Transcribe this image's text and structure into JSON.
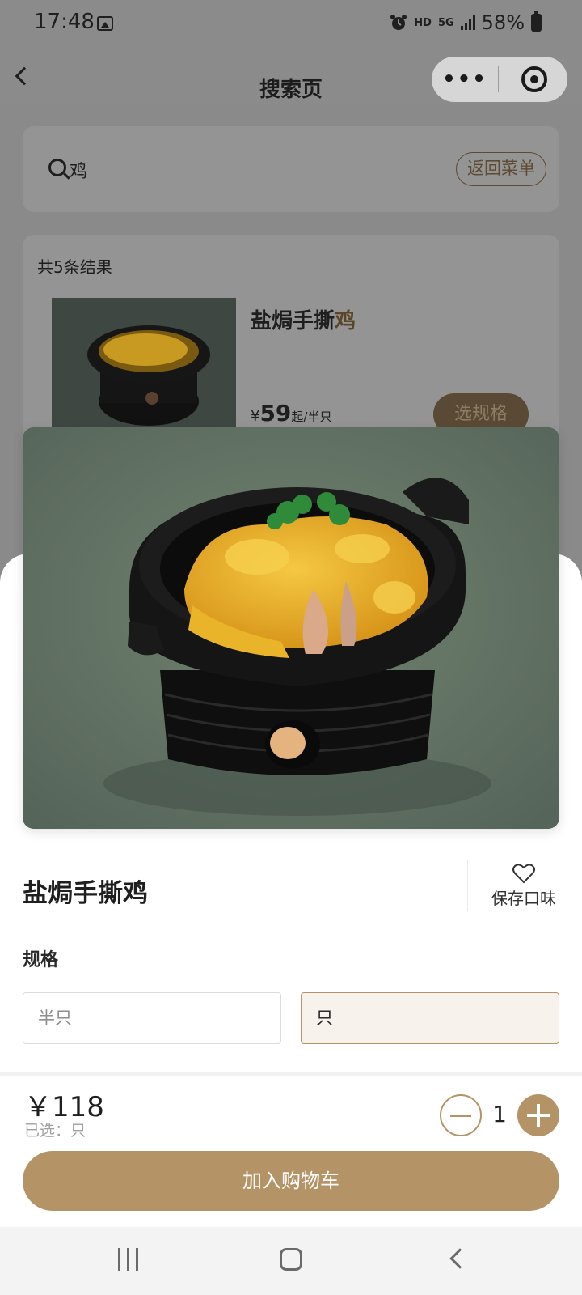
{
  "status_bar": {
    "time": "17:48",
    "hd": "HD",
    "net": "5G",
    "battery": "58%"
  },
  "navbar": {
    "title": "搜索页",
    "more_icon": "•••"
  },
  "search": {
    "query": "鸡",
    "back_menu_label": "返回菜单"
  },
  "results": {
    "count_text": "共5条结果",
    "items": [
      {
        "name_prefix": "盐焗手撕",
        "name_highlight": "鸡",
        "currency": "¥",
        "price": "59",
        "unit": "起/半只",
        "spec_button": "选规格"
      }
    ]
  },
  "sheet": {
    "dish_name": "盐焗手撕鸡",
    "save_label": "保存口味",
    "spec_title": "规格",
    "options": [
      {
        "label": "半只",
        "selected": false
      },
      {
        "label": "只",
        "selected": true
      }
    ],
    "total": "￥118",
    "selected_text": "已选：只",
    "quantity": "1",
    "add_to_cart": "加入购物车"
  },
  "colors": {
    "accent": "#b49366",
    "accent_light": "#f7f2ec"
  }
}
